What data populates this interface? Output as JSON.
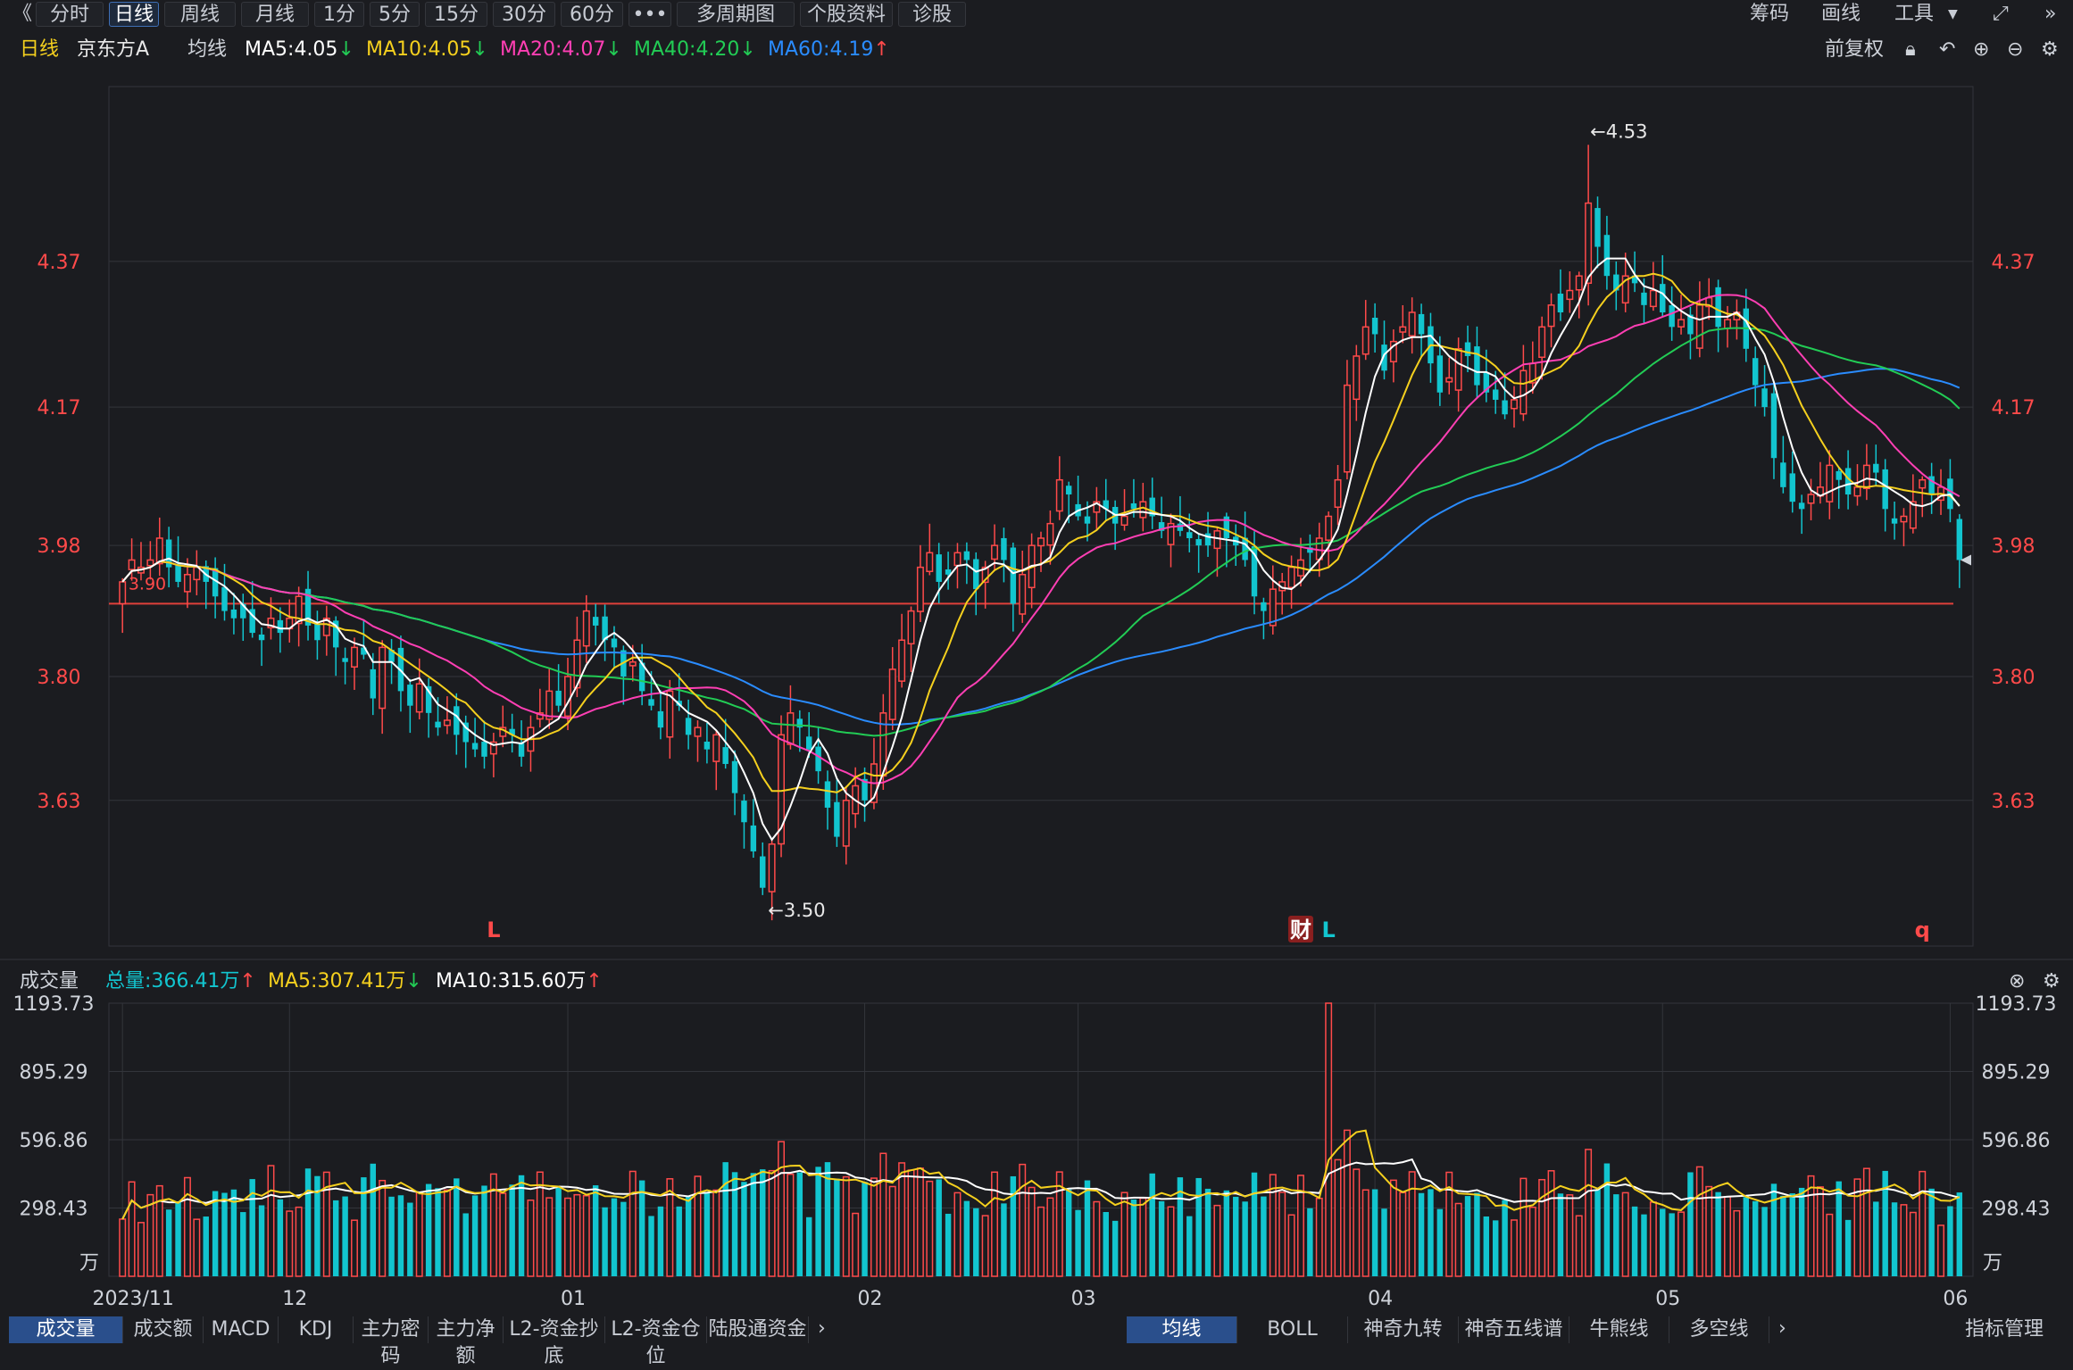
{
  "toolbar": {
    "back": "《",
    "periods": [
      "分时",
      "日线",
      "周线",
      "月线",
      "1分",
      "5分",
      "15分",
      "30分",
      "60分",
      "•••",
      "多周期图",
      "个股资料",
      "诊股"
    ],
    "active_index": 1,
    "right": [
      "筹码",
      "画线",
      "工具"
    ],
    "expand_icon": "expand-icon",
    "collapse_icon": "double-chevron-right-icon"
  },
  "info": {
    "period": "日线",
    "stock": "京东方A",
    "ma_label": "均线",
    "ma5": "MA5:4.05",
    "ma10": "MA10:4.05",
    "ma20": "MA20:4.07",
    "ma40": "MA40:4.20",
    "ma60": "MA60:4.19",
    "right_label": "前复权",
    "ma5_arrow": "↓",
    "ma10_arrow": "↓",
    "ma20_arrow": "↓",
    "ma40_arrow": "↓",
    "ma60_arrow": "↑"
  },
  "volume_info": {
    "label": "成交量",
    "total": "总量:366.41万",
    "ma5": "MA5:307.41万",
    "ma10": "MA10:315.60万",
    "total_arrow": "↑",
    "ma5_arrow": "↓",
    "ma10_arrow": "↑"
  },
  "colors": {
    "up": "#ff4a4a",
    "down": "#12c5cf",
    "ma5": "#ffffff",
    "ma10": "#f5d01e",
    "ma20": "#ff3fb4",
    "ma40": "#22cc55",
    "ma60": "#2a8cff",
    "grid": "#33353b",
    "ref_line": "#e0403a"
  },
  "markers": {
    "high_label": "←4.53",
    "low_label": "←3.50",
    "cut_label": "3.90",
    "events": [
      "L",
      "财",
      "L",
      "q"
    ]
  },
  "bottom_tabs": {
    "left": [
      "成交量",
      "成交额",
      "MACD",
      "KDJ",
      "主力密码",
      "主力净额",
      "L2-资金抄底",
      "L2-资金仓位",
      "陆股通资金"
    ],
    "right": [
      "均线",
      "BOLL",
      "神奇九转",
      "神奇五线谱",
      "牛熊线",
      "多空线"
    ],
    "manage": "指标管理"
  },
  "chart_data": [
    {
      "type": "candlestick",
      "title": "京东方A 日线",
      "y_ticks": [
        "3.63",
        "3.80",
        "3.98",
        "4.17",
        "4.37"
      ],
      "ylim": [
        3.43,
        4.61
      ],
      "reference_price": 3.9,
      "high": {
        "value": 4.53,
        "label": "←4.53"
      },
      "low": {
        "value": 3.5,
        "label": "←3.50"
      },
      "x_ticks": [
        "2023/11",
        "12",
        "01",
        "02",
        "03",
        "04",
        "05",
        "06"
      ],
      "x_tick_indices": [
        0,
        18,
        48,
        80,
        103,
        135,
        166,
        197
      ],
      "ohlc_close": [
        3.93,
        3.96,
        3.95,
        3.96,
        3.99,
        3.95,
        3.93,
        3.94,
        3.95,
        3.93,
        3.91,
        3.89,
        3.88,
        3.88,
        3.86,
        3.85,
        3.88,
        3.86,
        3.88,
        3.91,
        3.87,
        3.85,
        3.88,
        3.84,
        3.82,
        3.84,
        3.83,
        3.77,
        3.84,
        3.82,
        3.78,
        3.76,
        3.79,
        3.75,
        3.73,
        3.74,
        3.72,
        3.71,
        3.7,
        3.69,
        3.71,
        3.73,
        3.72,
        3.69,
        3.73,
        3.75,
        3.78,
        3.76,
        3.8,
        3.85,
        3.89,
        3.87,
        3.85,
        3.84,
        3.8,
        3.82,
        3.78,
        3.76,
        3.73,
        3.78,
        3.76,
        3.72,
        3.73,
        3.7,
        3.72,
        3.68,
        3.64,
        3.6,
        3.56,
        3.51,
        3.57,
        3.72,
        3.75,
        3.73,
        3.7,
        3.67,
        3.62,
        3.58,
        3.63,
        3.65,
        3.63,
        3.68,
        3.75,
        3.81,
        3.85,
        3.89,
        3.95,
        3.97,
        3.93,
        3.94,
        3.97,
        3.96,
        3.92,
        3.95,
        3.98,
        3.96,
        3.9,
        3.94,
        3.98,
        3.99,
        4.01,
        4.07,
        4.05,
        4.02,
        4.01,
        4.04,
        4.03,
        4.01,
        4.02,
        4.03,
        4.04,
        4.02,
        4.0,
        4.01,
        4.0,
        3.99,
        3.98,
        3.98,
        4.0,
        3.99,
        3.98,
        3.96,
        3.91,
        3.89,
        3.92,
        3.93,
        3.95,
        3.96,
        3.97,
        3.99,
        4.02,
        4.07,
        4.2,
        4.24,
        4.28,
        4.27,
        4.22,
        4.26,
        4.28,
        4.3,
        4.27,
        4.23,
        4.19,
        4.21,
        4.25,
        4.24,
        4.2,
        4.19,
        4.18,
        4.16,
        4.18,
        4.22,
        4.23,
        4.28,
        4.31,
        4.3,
        4.33,
        4.35,
        4.45,
        4.39,
        4.35,
        4.33,
        4.35,
        4.34,
        4.31,
        4.33,
        4.3,
        4.28,
        4.29,
        4.27,
        4.31,
        4.32,
        4.28,
        4.29,
        4.3,
        4.25,
        4.2,
        4.17,
        4.1,
        4.06,
        4.04,
        4.03,
        4.05,
        4.06,
        4.09,
        4.07,
        4.05,
        4.06,
        4.09,
        4.08,
        4.03,
        4.01,
        4.02,
        4.04,
        4.07,
        4.05,
        4.06,
        4.03,
        3.96
      ],
      "ma_series": [
        {
          "name": "MA5",
          "last": 4.05
        },
        {
          "name": "MA10",
          "last": 4.05
        },
        {
          "name": "MA20",
          "last": 4.07
        },
        {
          "name": "MA40",
          "last": 4.2
        },
        {
          "name": "MA60",
          "last": 4.19
        }
      ]
    },
    {
      "type": "bar",
      "title": "成交量",
      "unit": "万",
      "y_ticks": [
        "298.43",
        "596.86",
        "895.29",
        "1193.73"
      ],
      "ylim": [
        0,
        1193.73
      ],
      "legend": [
        "总量:366.41万",
        "MA5:307.41万",
        "MA10:315.60万"
      ],
      "peak_value": 1193.73
    }
  ]
}
